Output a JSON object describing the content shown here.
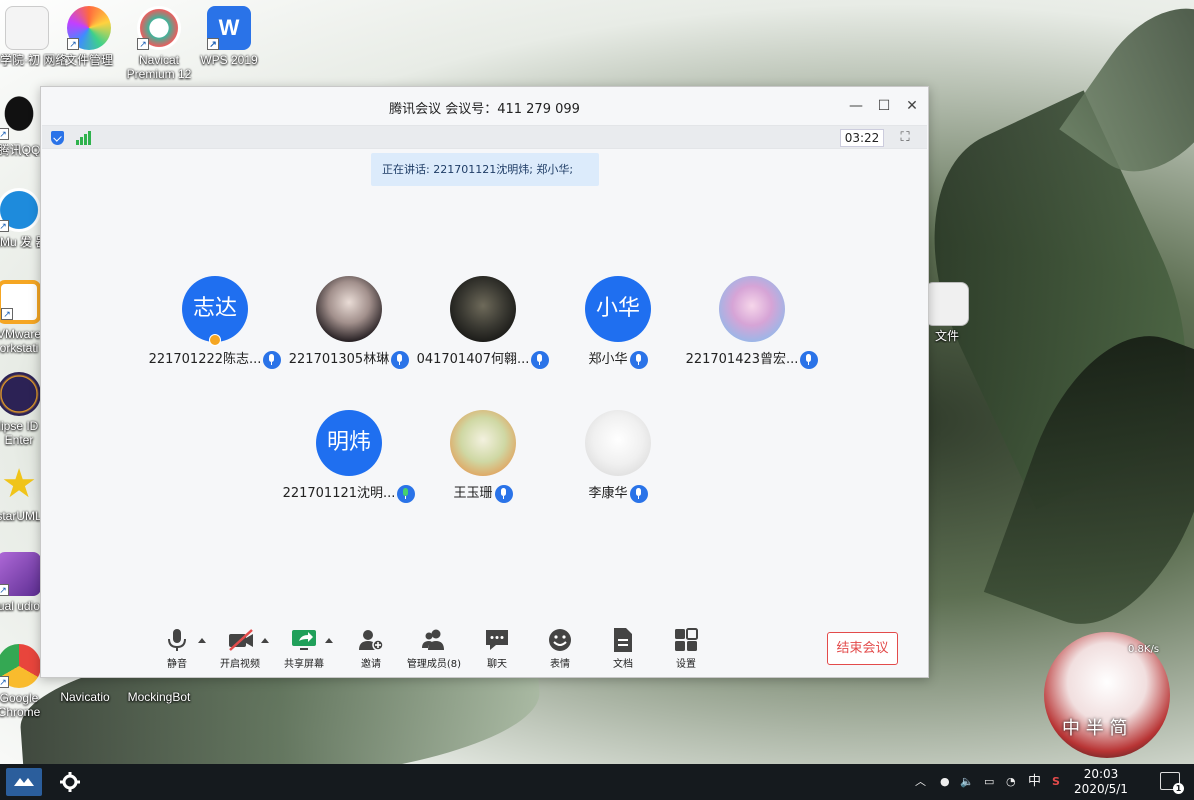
{
  "desktop": {
    "icons": [
      {
        "label": "科学院·初 网络工程...",
        "icon": "document-icon",
        "color": "#f2f2f2"
      },
      {
        "label": "文件管理",
        "icon": "file-manager-icon",
        "color": "#ff6a3d"
      },
      {
        "label": "Navicat Premium 12",
        "icon": "navicat-icon",
        "color": "#2a9d8f"
      },
      {
        "label": "WPS 2019",
        "icon": "wps-icon",
        "color": "#2a73e8"
      },
      {
        "label": "腾讯QQ",
        "icon": "qq-icon",
        "color": "#111111"
      },
      {
        "label": "LiMu 发 器",
        "icon": "app-icon",
        "color": "#1e8bdc"
      },
      {
        "label": "VMware orkstati",
        "icon": "vmware-icon",
        "color": "#f5a623"
      },
      {
        "label": "clipse ID r Enter",
        "icon": "eclipse-icon",
        "color": "#2c2255"
      },
      {
        "label": "starUML",
        "icon": "staruml-icon",
        "color": "#f0c419"
      },
      {
        "label": "Visual udio 20",
        "icon": "visual-studio-icon",
        "color": "#7b3fb5"
      },
      {
        "label": "Google Chrome",
        "icon": "chrome-icon",
        "color": "#e8453c"
      },
      {
        "label": "Navicatio",
        "icon": "navicat-icon",
        "color": "#333333"
      },
      {
        "label": "MockingBot",
        "icon": "mockingbot-icon",
        "color": "#222222"
      },
      {
        "label": "文件",
        "icon": "folder-icon",
        "color": "#e6e6e6"
      }
    ]
  },
  "window": {
    "title": "腾讯会议 会议号：411 279 099",
    "minimize": "—",
    "maximize": "☐",
    "close": "✕"
  },
  "status": {
    "timer": "03:22",
    "fullscreen": "⛶"
  },
  "speaking": "正在讲话: 221701121沈明炜; 郑小华;",
  "participants": [
    {
      "name": "221701222陈志...",
      "avatar_text": "志达",
      "host": true,
      "mic_active": false
    },
    {
      "name": "221701305林琳",
      "avatar_text": "",
      "mic_active": false
    },
    {
      "name": "041701407何翱...",
      "avatar_text": "",
      "mic_active": false
    },
    {
      "name": "郑小华",
      "avatar_text": "小华",
      "mic_active": false
    },
    {
      "name": "221701423曾宏...",
      "avatar_text": "",
      "mic_active": false
    },
    {
      "name": "221701121沈明...",
      "avatar_text": "明炜",
      "mic_active": true
    },
    {
      "name": "王玉珊",
      "avatar_text": "",
      "mic_active": false
    },
    {
      "name": "李康华",
      "avatar_text": "",
      "mic_active": false
    }
  ],
  "toolbar": {
    "mute": "静音",
    "video": "开启视频",
    "share": "共享屏幕",
    "invite": "邀请",
    "members": "管理成员(8)",
    "chat": "聊天",
    "emoji": "表情",
    "docs": "文档",
    "settings": "设置",
    "end": "结束会议"
  },
  "taskbar": {
    "ime": "中",
    "time": "20:03",
    "date": "2020/5/1",
    "notifications": "1"
  },
  "widget": {
    "speed": "0.8K/s",
    "chars": "中 半 简"
  },
  "colors": {
    "accent": "#1f6ff0",
    "end": "#e34b4b",
    "speaking_bg": "#dcebfb"
  }
}
